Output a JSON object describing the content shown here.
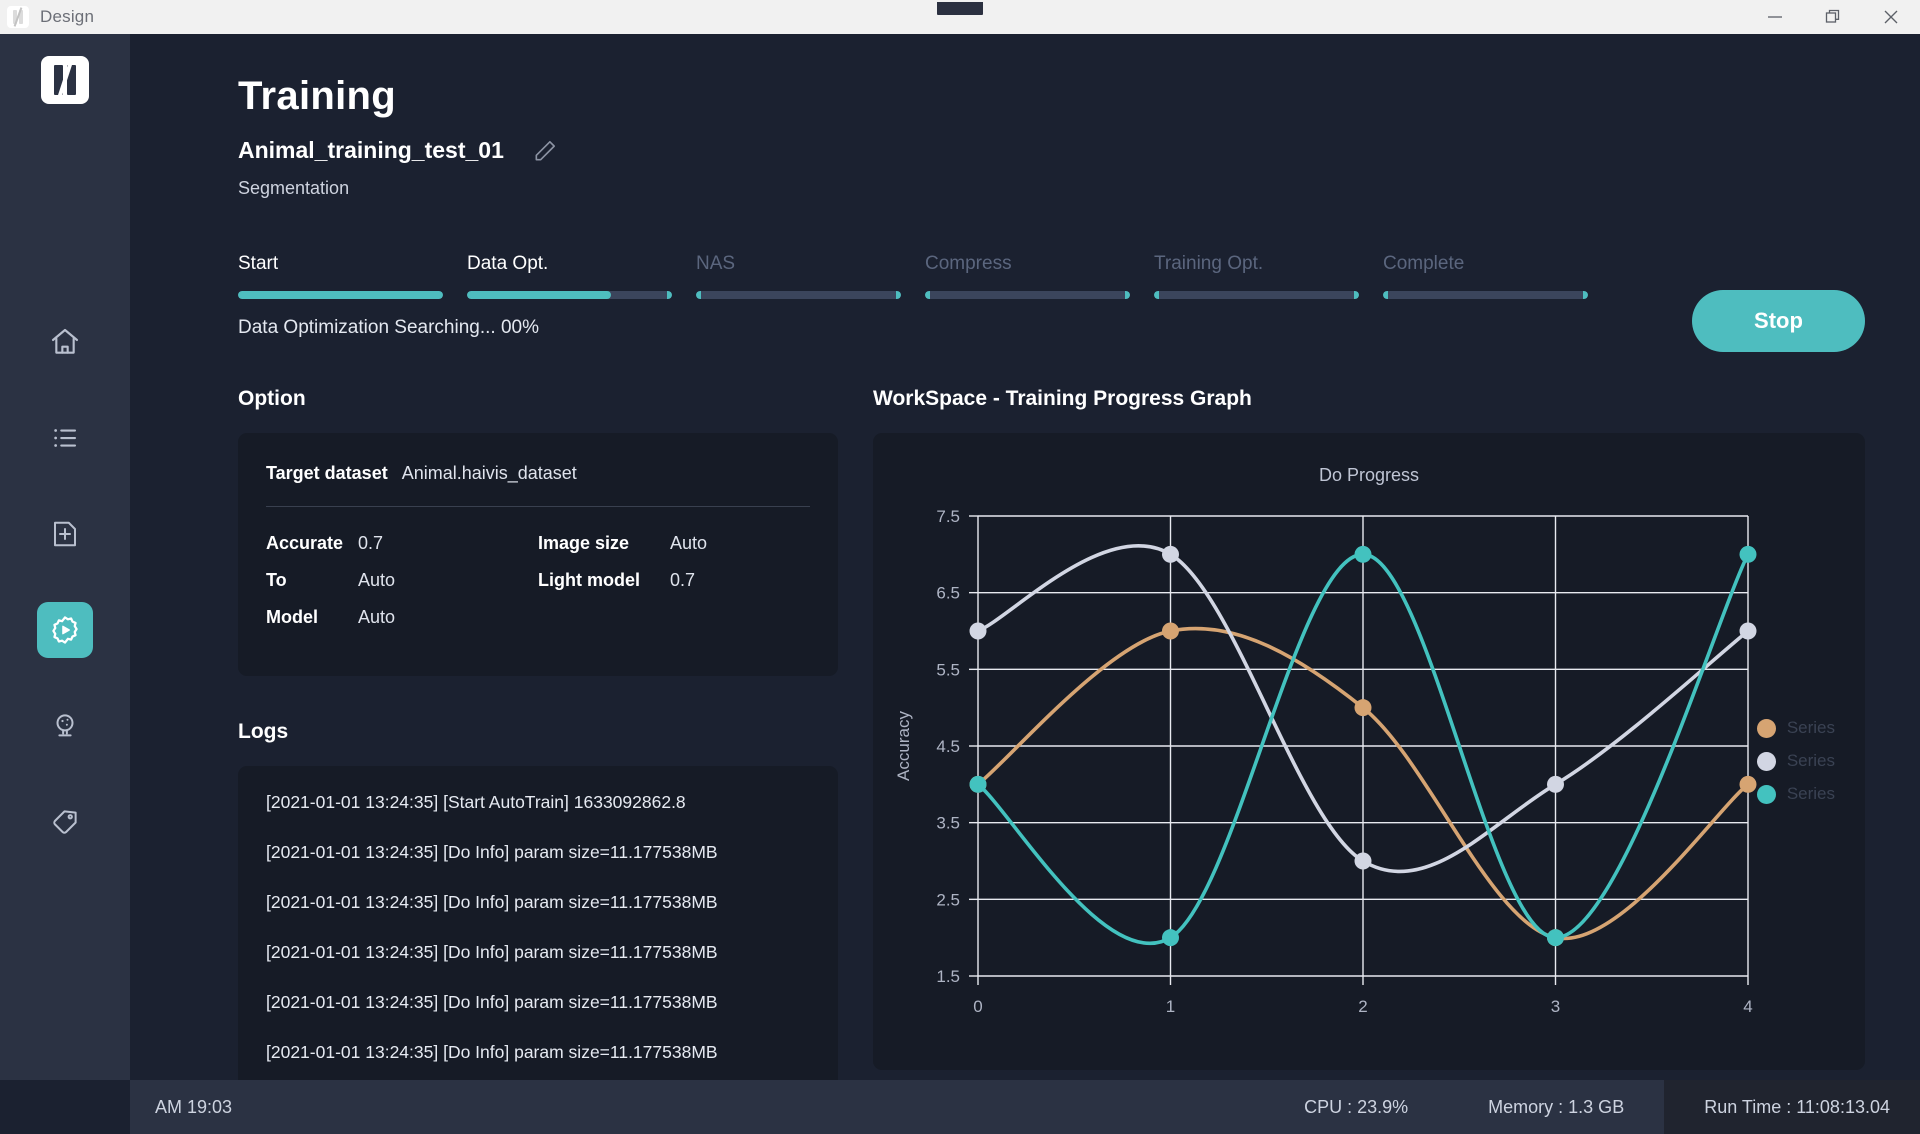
{
  "titlebar": {
    "app_name": "Design",
    "logo_icon": "haivis-logo-icon",
    "minimize_icon": "minimize-icon",
    "maximize_icon": "restore-icon",
    "close_icon": "close-icon"
  },
  "sidebar": {
    "logo_icon": "brand-logo-icon",
    "items": [
      {
        "icon": "home-icon",
        "name": "home"
      },
      {
        "icon": "list-icon",
        "name": "projects"
      },
      {
        "icon": "new-file-icon",
        "name": "new-dataset"
      },
      {
        "icon": "training-gear-icon",
        "name": "training",
        "active": true
      },
      {
        "icon": "deploy-icon",
        "name": "deploy"
      },
      {
        "icon": "tag-icon",
        "name": "labeling"
      }
    ]
  },
  "header": {
    "title": "Training",
    "project_name": "Animal_training_test_01",
    "edit_icon": "pencil-icon",
    "category": "Segmentation"
  },
  "stepper": {
    "steps": [
      {
        "label": "Start",
        "state": "done",
        "fill_percent": 100
      },
      {
        "label": "Data Opt.",
        "state": "current",
        "fill_percent": 70
      },
      {
        "label": "NAS",
        "state": "pending",
        "fill_percent": 0
      },
      {
        "label": "Compress",
        "state": "pending",
        "fill_percent": 0
      },
      {
        "label": "Training Opt.",
        "state": "pending",
        "fill_percent": 0
      },
      {
        "label": "Complete",
        "state": "pending",
        "fill_percent": 0
      }
    ],
    "progress_text": "Data Optimization Searching... 00%",
    "accent_color": "#4ebdbf",
    "track_color": "#3b455c"
  },
  "actions": {
    "stop_label": "Stop"
  },
  "option": {
    "section_title": "Option",
    "target_dataset_key": "Target dataset",
    "target_dataset_value": "Animal.haivis_dataset",
    "left_rows": [
      {
        "key": "Accurate",
        "value": "0.7"
      },
      {
        "key": "To",
        "value": "Auto"
      },
      {
        "key": "Model",
        "value": "Auto"
      }
    ],
    "right_rows": [
      {
        "key": "Image size",
        "value": "Auto"
      },
      {
        "key": "Light model",
        "value": "0.7"
      }
    ]
  },
  "logs": {
    "section_title": "Logs",
    "entries": [
      "[2021-01-01 13:24:35] [Start AutoTrain] 1633092862.8",
      "[2021-01-01 13:24:35] [Do Info] param size=11.177538MB",
      "[2021-01-01 13:24:35] [Do Info] param size=11.177538MB",
      "[2021-01-01 13:24:35] [Do Info] param size=11.177538MB",
      "[2021-01-01 13:24:35] [Do Info] param size=11.177538MB",
      "[2021-01-01 13:24:35] [Do Info] param size=11.177538MB"
    ]
  },
  "workspace": {
    "section_title": "WorkSpace - Training Progress Graph"
  },
  "chart_data": {
    "type": "line",
    "title": "Do Progress",
    "xlabel": "",
    "ylabel": "Accuracy",
    "x": [
      0,
      1,
      2,
      3,
      4
    ],
    "xticks": [
      "0",
      "1",
      "2",
      "3",
      "4"
    ],
    "yticks": [
      "1.5",
      "2.5",
      "3.5",
      "4.5",
      "5.5",
      "6.5",
      "7.5"
    ],
    "xlim": [
      0,
      4
    ],
    "ylim": [
      1.5,
      7.5
    ],
    "grid": true,
    "legend_position": "right",
    "series": [
      {
        "name": "Series",
        "color": "#d6a472",
        "values": [
          4.0,
          6.0,
          5.0,
          2.0,
          4.0
        ]
      },
      {
        "name": "Series",
        "color": "#d2d6e3",
        "values": [
          6.0,
          7.0,
          3.0,
          4.0,
          6.0
        ]
      },
      {
        "name": "Series",
        "color": "#43c2bf",
        "values": [
          4.0,
          2.0,
          7.0,
          2.0,
          7.0
        ]
      }
    ]
  },
  "statusbar": {
    "time": "AM 19:03",
    "cpu": "CPU : 23.9%",
    "memory": "Memory : 1.3 GB",
    "runtime": "Run Time : 11:08:13.04"
  }
}
